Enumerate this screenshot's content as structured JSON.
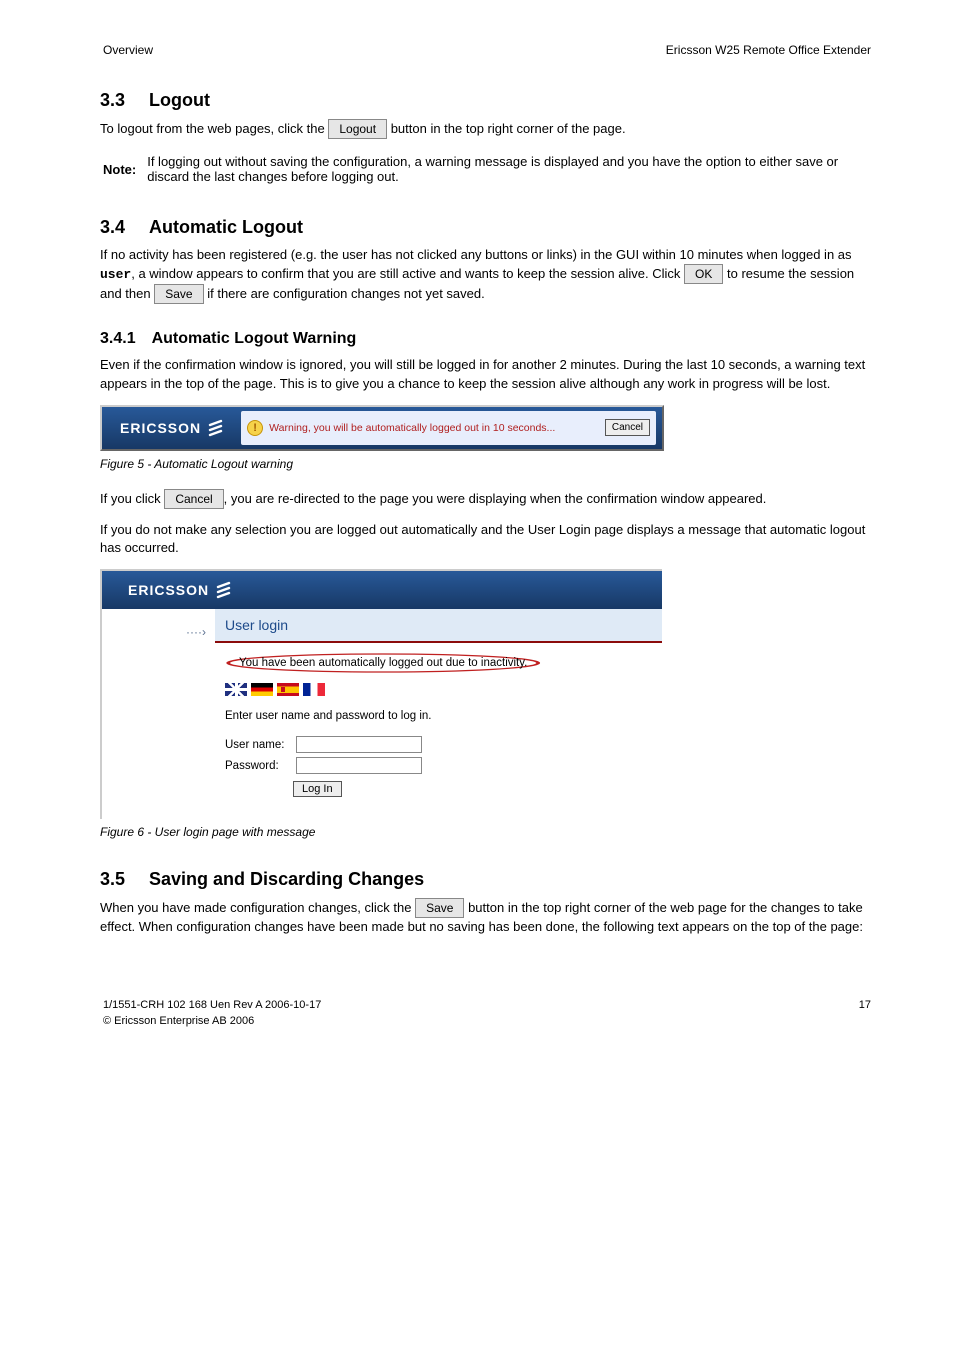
{
  "header": {
    "left": "Overview",
    "right": "Ericsson W25 Remote Office Extender"
  },
  "sec1": {
    "num": "3.3",
    "title": "Logout",
    "p1a": "To logout from the web pages, click the",
    "logout_button": "Logout",
    "p1b": "button in the top right corner of the page.",
    "note_label": "Note:",
    "note_text": "If logging out without saving the configuration, a warning message is displayed and you have the option to either save or discard the last changes before logging out."
  },
  "sec2": {
    "num": "3.4",
    "title": "Automatic Logout",
    "p1a": "If no activity has been registered (e.g. the user has not clicked any buttons or links) in the GUI within 10 minutes when logged in as",
    "user_word": "user",
    "p1b": ", a window appears to confirm that you are still active and wants to keep the session alive. Click",
    "ok_button": "OK",
    "p1c": "to resume the session and then",
    "save_button": "Save",
    "p1d": "if there are configuration changes not yet saved."
  },
  "sec2_1": {
    "num": "3.4.1",
    "title": "Automatic Logout Warning",
    "p1": "Even if the confirmation window is ignored, you will still be logged in for another 2 minutes. During the last 10 seconds, a warning text appears in the top of the page. This is to give you a chance to keep the session alive although any work in progress will be lost.",
    "fig1_cap": "Figure 5 - Automatic Logout warning",
    "p2a": "If you click",
    "cancel_btn": "Cancel",
    "p2b": ", you are re-directed to the page you were displaying when the confirmation window appeared.",
    "p3": "If you do not make any selection you are logged out automatically and the User Login page displays a message that automatic logout has occurred.",
    "fig2_cap": "Figure 6 - User login page with message"
  },
  "warnbar": {
    "logo": "ERICSSON",
    "text": "Warning, you will be automatically logged out in 10 seconds...",
    "cancel": "Cancel"
  },
  "loginpage": {
    "logo": "ERICSSON",
    "arrow": "····›",
    "title": "User login",
    "logout_msg": "You have been automatically logged out due to inactivity.",
    "prompt": "Enter user name and password to log in.",
    "username_label": "User name:",
    "password_label": "Password:",
    "login_btn": "Log In"
  },
  "sec3": {
    "num": "3.5",
    "title": "Saving and Discarding Changes",
    "p1a": "When you have made configuration changes, click the",
    "save_btn": "Save",
    "p1b": "button in the top right corner of the web page for the changes to take effect. When configuration changes have been made but no saving has been done, the following text appears on the top of the page:"
  },
  "footer": {
    "ref": "1/1551-CRH 102 168 Uen Rev A 2006-10-17",
    "copyright": "© Ericsson Enterprise AB 2006",
    "page": "17"
  }
}
